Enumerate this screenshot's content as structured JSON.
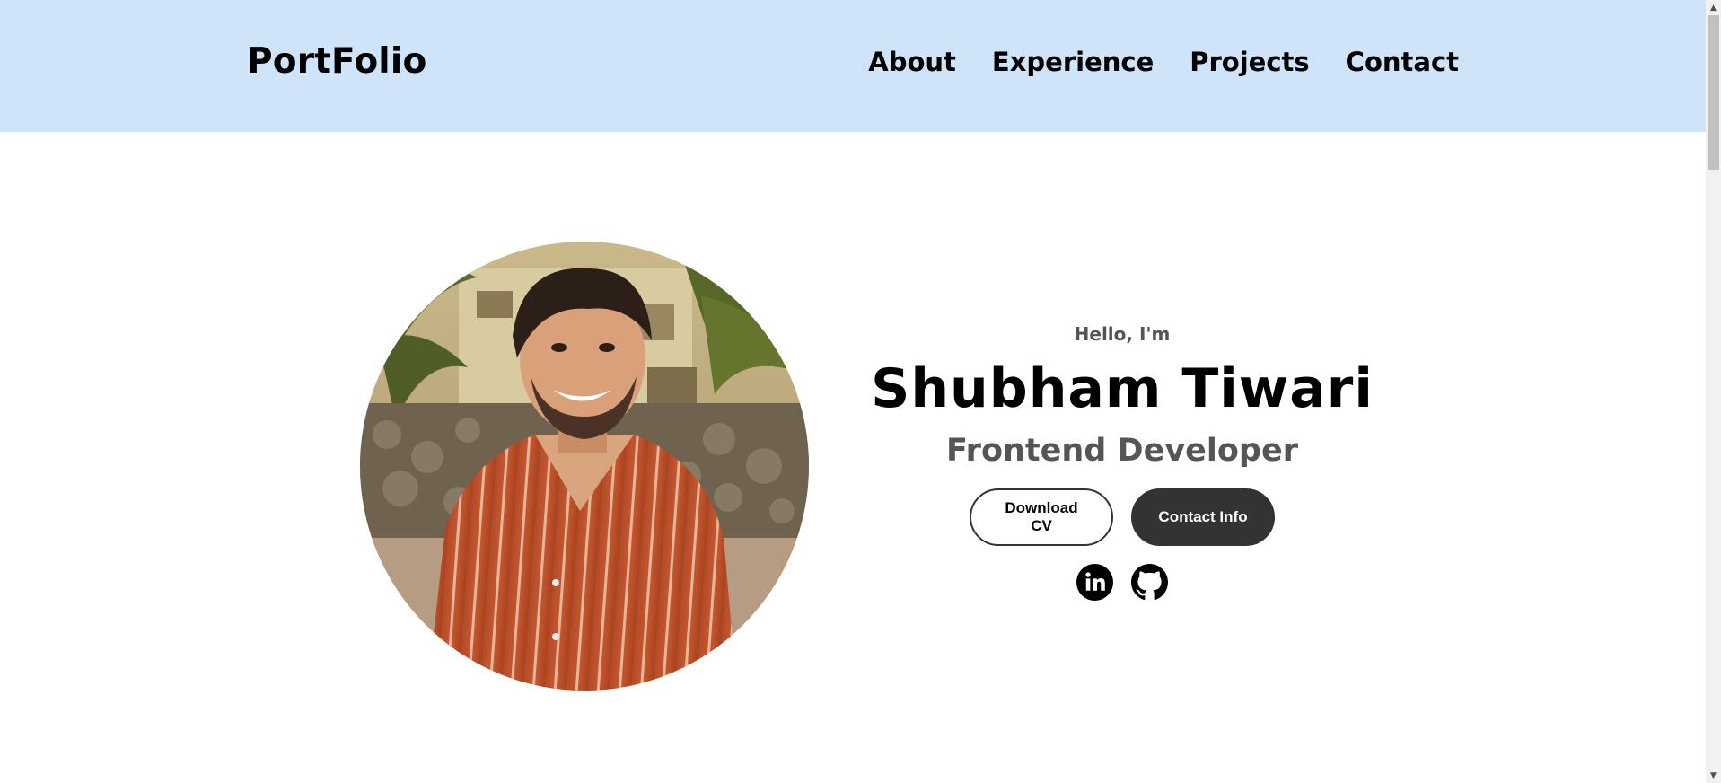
{
  "header": {
    "logo": "PortFolio",
    "nav": [
      "About",
      "Experience",
      "Projects",
      "Contact"
    ],
    "background": "#cfe4f8"
  },
  "hero": {
    "greeting": "Hello, I'm",
    "name": "Shubham Tiwari",
    "role": "Frontend Developer",
    "buttons": {
      "download_cv": "Download CV",
      "contact_info": "Contact Info"
    },
    "socials": [
      "linkedin-icon",
      "github-icon"
    ],
    "colors": {
      "dark": "#333333",
      "muted": "#555555"
    }
  },
  "scrollbar": {
    "up": "▲",
    "down": "▼"
  }
}
